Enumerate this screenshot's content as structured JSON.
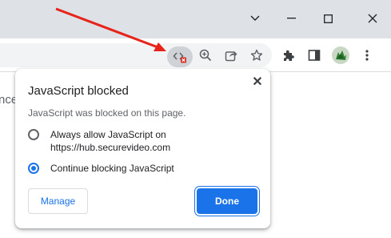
{
  "page": {
    "partial_text": "nce"
  },
  "popup": {
    "title": "JavaScript blocked",
    "description": "JavaScript was blocked on this page.",
    "options": [
      {
        "label": "Always allow JavaScript on https://hub.securevideo.com",
        "selected": false
      },
      {
        "label": "Continue blocking JavaScript",
        "selected": true
      }
    ],
    "manage_label": "Manage",
    "done_label": "Done"
  },
  "icons": {
    "js_blocked": "javascript-blocked-icon",
    "zoom": "zoom-icon",
    "share": "share-icon",
    "bookmark": "star-icon",
    "extensions": "puzzle-icon",
    "side_panel": "side-panel-icon",
    "profile": "avatar",
    "menu": "kebab-menu-icon"
  },
  "colors": {
    "accent": "#1a73e8",
    "annotation_arrow": "#e8231a",
    "titlebar": "#dee1e6"
  }
}
